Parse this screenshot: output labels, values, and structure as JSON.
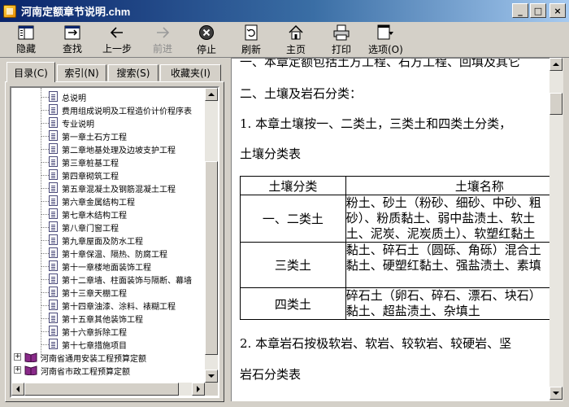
{
  "window": {
    "title": "河南定额章节说明.chm",
    "buttons": {
      "minimize": "_",
      "maximize": "□",
      "close": "×"
    }
  },
  "toolbar": {
    "items": [
      {
        "label": "隐藏",
        "icon": "hide-pane-icon"
      },
      {
        "label": "查找",
        "icon": "locate-icon"
      },
      {
        "label": "上一步",
        "icon": "back-arrow-icon"
      },
      {
        "label": "前进",
        "icon": "forward-arrow-icon",
        "disabled": true
      },
      {
        "label": "停止",
        "icon": "stop-icon"
      },
      {
        "label": "刷新",
        "icon": "refresh-icon"
      },
      {
        "label": "主页",
        "icon": "home-icon"
      },
      {
        "label": "打印",
        "icon": "print-icon"
      },
      {
        "label": "选项(O)",
        "icon": "options-icon"
      }
    ]
  },
  "tabs": [
    {
      "label": "目录(C)",
      "active": true
    },
    {
      "label": "索引(N)"
    },
    {
      "label": "搜索(S)"
    },
    {
      "label": "收藏夹(I)"
    }
  ],
  "tree": {
    "pages": [
      "总说明",
      "费用组成说明及工程造价计价程序表",
      "专业说明",
      "第一章土石方工程",
      "第二章地基处理及边坡支护工程",
      "第三章桩基工程",
      "第四章砌筑工程",
      "第五章混凝土及钢筋混凝土工程",
      "第六章金属结构工程",
      "第七章木结构工程",
      "第八章门窗工程",
      "第九章屋面及防水工程",
      "第十章保温、隔热、防腐工程",
      "第十一章楼地面装饰工程",
      "第十二章墙、柱面装饰与隔断、幕墙",
      "第十三章天棚工程",
      "第十四章油漆、涂料、裱糊工程",
      "第十五章其他装饰工程",
      "第十六章拆除工程",
      "第十七章措施项目"
    ],
    "books": [
      "河南省通用安装工程预算定额",
      "河南省市政工程预算定额"
    ]
  },
  "content": {
    "line_top": "一、本章定额包括土方工程、石方工程、回填及其它",
    "heading2": "二、土壤及岩石分类：",
    "para1": "1. 本章土壤按一、二类土，三类土和四类土分类，",
    "table_title": "土壤分类表",
    "table": {
      "headers": [
        "土壤分类",
        "土壤名称"
      ],
      "rows": [
        {
          "category": "一、二类土",
          "lines": [
            "粉土、砂土（粉砂、细砂、中砂、粗",
            "砂）、粉质黏土、弱中盐渍土、软土",
            "土、泥炭、泥炭质土）、软塑红黏土"
          ]
        },
        {
          "category": "三类土",
          "lines": [
            "黏土、碎石土（圆砾、角砾）混合土",
            "黏土、硬塑红黏土、强盐渍土、素填"
          ]
        },
        {
          "category": "四类土",
          "lines": [
            "碎石土（卵石、碎石、漂石、块石）",
            "黏土、超盐渍土、杂填土"
          ]
        }
      ]
    },
    "para2": "2. 本章岩石按极软岩、软岩、较软岩、较硬岩、坚",
    "rock_title": "岩石分类表"
  }
}
